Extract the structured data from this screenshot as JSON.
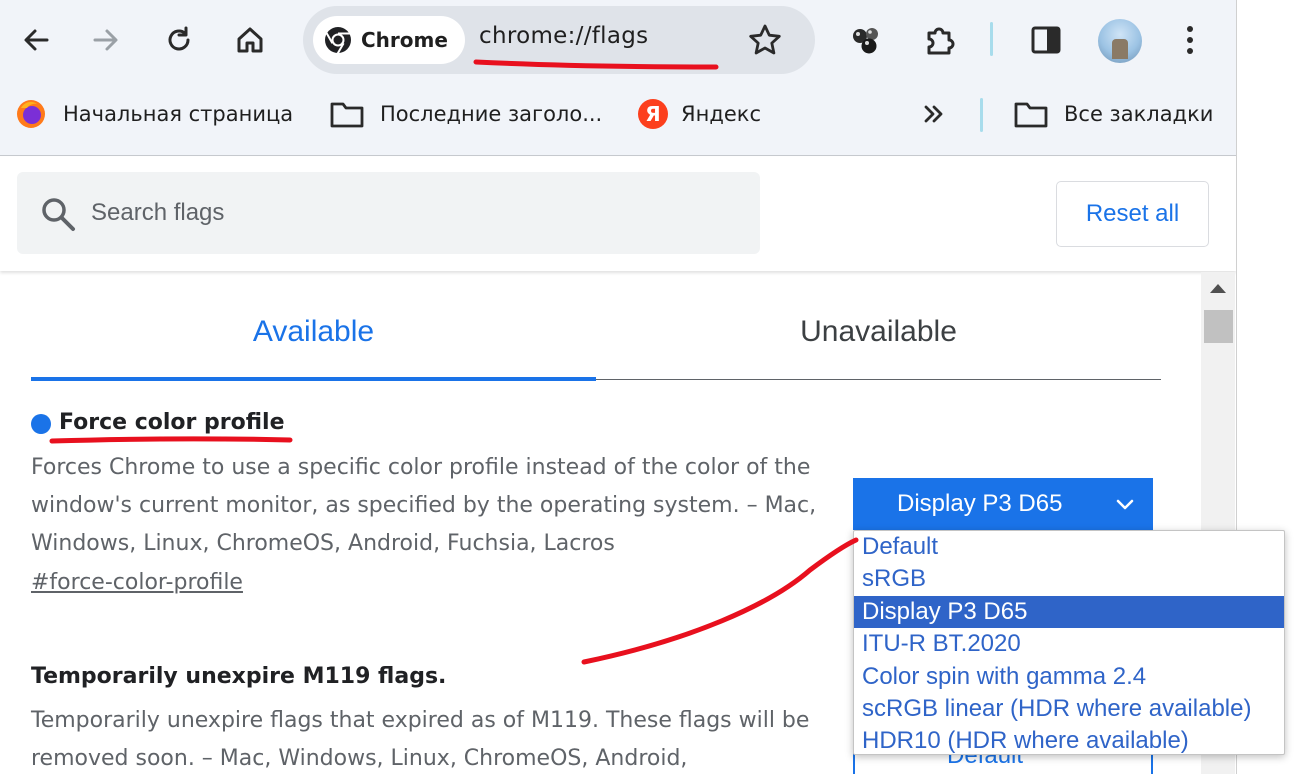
{
  "toolbar": {
    "back_icon": "arrow-left-icon",
    "forward_icon": "arrow-right-icon",
    "reload_icon": "reload-icon",
    "home_icon": "home-icon"
  },
  "omnibox": {
    "chip_label": "Chrome",
    "url": "chrome://flags"
  },
  "bookmarks": {
    "items": [
      {
        "label": "Начальная страница",
        "icon": "firefox-icon"
      },
      {
        "label": "Последние заголо...",
        "icon": "folder-icon"
      },
      {
        "label": "Яндекс",
        "icon": "yandex-icon"
      }
    ],
    "all_bookmarks": "Все закладки"
  },
  "flags_header": {
    "search_placeholder": "Search flags",
    "reset_label": "Reset all"
  },
  "tabs": {
    "available": "Available",
    "unavailable": "Unavailable"
  },
  "flags": [
    {
      "title": "Force color profile",
      "description": "Forces Chrome to use a specific color profile instead of the color of the window's current monitor, as specified by the operating system. – Mac, Windows, Linux, ChromeOS, Android, Fuchsia, Lacros",
      "link": "#force-color-profile",
      "selected": "Display P3 D65"
    },
    {
      "title": "Temporarily unexpire M119 flags.",
      "description": "Temporarily unexpire flags that expired as of M119. These flags will be removed soon. – Mac, Windows, Linux, ChromeOS, Android,",
      "selected": "Default"
    }
  ],
  "dropdown": {
    "options": [
      "Default",
      "sRGB",
      "Display P3 D65",
      "ITU-R BT.2020",
      "Color spin with gamma 2.4",
      "scRGB linear (HDR where available)",
      "HDR10 (HDR where available)"
    ],
    "selected_index": 2
  },
  "colors": {
    "accent": "#1a73e8",
    "annotation": "#e8101e",
    "option_text": "#2f64c8"
  }
}
